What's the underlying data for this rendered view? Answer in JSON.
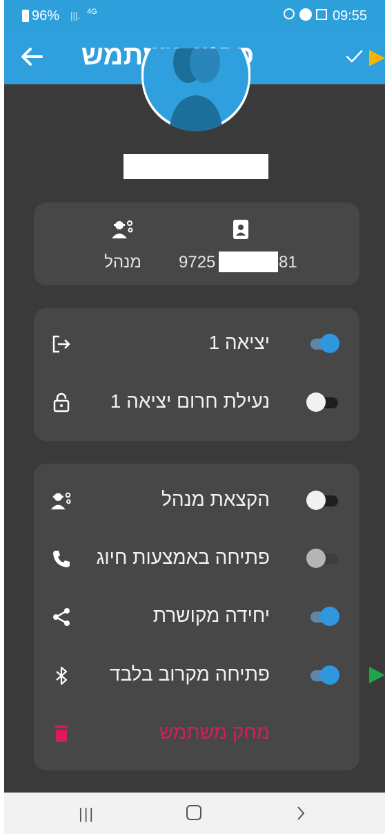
{
  "status_bar": {
    "battery": "96%",
    "network": "4G",
    "time": "09:55"
  },
  "header": {
    "title": "פרטי משתמש",
    "back_icon": "arrow-left-icon",
    "confirm_icon": "check-icon"
  },
  "user": {
    "role_label": "מנהל",
    "phone_prefix": "9725",
    "phone_suffix": "81"
  },
  "settings_card_1": {
    "rows": [
      {
        "label": "יציאה 1",
        "icon": "exit-icon",
        "enabled": true
      },
      {
        "label": "נעילת חרום יציאה 1",
        "icon": "lock-icon",
        "enabled": false
      }
    ]
  },
  "settings_card_2": {
    "rows": [
      {
        "label": "הקצאת מנהל",
        "icon": "admin-icon",
        "enabled": false
      },
      {
        "label": "פתיחה באמצעות חיוג",
        "icon": "phone-icon",
        "enabled": false,
        "disabled": true
      },
      {
        "label": "יחידה מקושרת",
        "icon": "share-icon",
        "enabled": true
      },
      {
        "label": "פתיחה מקרוב בלבד",
        "icon": "bluetooth-icon",
        "enabled": true
      }
    ],
    "delete_label": "מחק משתמש"
  },
  "colors": {
    "accent": "#2f9fdd",
    "toggle_on": "#2f96e0",
    "danger": "#d81b60",
    "card_bg": "#474747",
    "bg": "#3a3a3a"
  }
}
